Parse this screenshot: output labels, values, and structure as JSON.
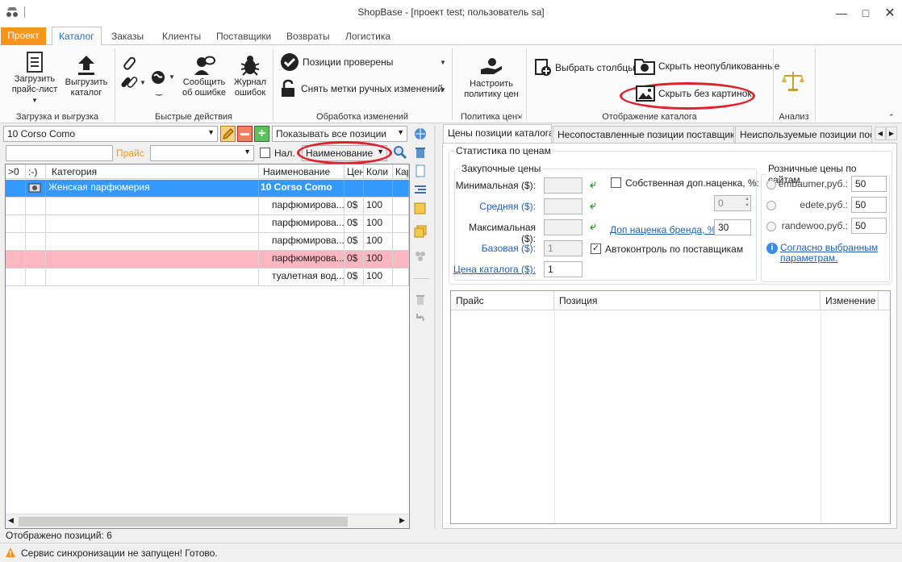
{
  "window": {
    "title": "ShopBase - [проект test; пользователь sa]"
  },
  "ribbon_tabs": [
    "Проект",
    "Каталог",
    "Заказы",
    "Клиенты",
    "Поставщики",
    "Возвраты",
    "Логистика"
  ],
  "groups": {
    "load": {
      "label": "Загрузка и выгрузка",
      "load_price_line1": "Загрузить",
      "load_price_line2": "прайс-лист",
      "export_line1": "Выгрузить",
      "export_line2": "каталог"
    },
    "quick": {
      "label": "Быстрые действия",
      "report_line1": "Сообщить",
      "report_line2": "об ошибке",
      "journal_line1": "Журнал",
      "journal_line2": "ошибок"
    },
    "changes": {
      "label": "Обработка изменений",
      "checked": "Позиции проверены",
      "remove_marks": "Снять метки ручных изменений"
    },
    "policy": {
      "label": "Политика цен",
      "setup_line1": "Настроить",
      "setup_line2": "политику цен"
    },
    "display": {
      "label": "Отображение каталога",
      "select_columns": "Выбрать столбцы",
      "hide_unpublished": "Скрыть неопубликованные",
      "hide_no_images": "Скрыть без картинок"
    },
    "analysis": {
      "label": "Анализ"
    }
  },
  "left": {
    "catalog_select": "10 Corso Como",
    "show_select": "Показывать все позиции",
    "price_label": "Прайс",
    "nal_label": "Нал.",
    "sort_select": "Наименование",
    "columns": [
      ">0",
      ":-)",
      "Категория",
      "Наименование",
      "Цен",
      "Коли",
      "Кар"
    ],
    "rows": [
      {
        "category": "Женская парфюмерия",
        "name": "10 Corso Como",
        "price": "",
        "qty": "",
        "state": "selected"
      },
      {
        "category": "",
        "name": "парфюмирова...",
        "price": "0$",
        "qty": "100",
        "state": "normal"
      },
      {
        "category": "",
        "name": "парфюмирова...",
        "price": "0$",
        "qty": "100",
        "state": "normal"
      },
      {
        "category": "",
        "name": "парфюмирова...",
        "price": "0$",
        "qty": "100",
        "state": "normal"
      },
      {
        "category": "",
        "name": "парфюмирова...",
        "price": "0$",
        "qty": "100",
        "state": "pink"
      },
      {
        "category": "",
        "name": "туалетная вод...",
        "price": "0$",
        "qty": "100",
        "state": "normal"
      }
    ]
  },
  "right": {
    "tabs": [
      "Цены позиции каталога",
      "Несопоставленные позиции поставщиков",
      "Неиспользуемые позиции поста"
    ],
    "stats_title": "Статистика по ценам",
    "purchase_title": "Закупочные цены",
    "min_label": "Минимальная ($):",
    "avg_label": "Средняя ($):",
    "max_label": "Максимальная ($):",
    "base_label": "Базовая ($):",
    "base_value": "1",
    "catalog_price_label": "Цена каталога ($):",
    "catalog_price_value": "1",
    "own_markup_label": "Собственная доп.наценка, %:",
    "own_markup_value": "0",
    "brand_markup_label": "Доп наценка бренда, %:",
    "brand_markup_value": "30",
    "autocontrol_label": "Автоконтроль по поставщикам",
    "retail_title": "Розничные цены по сайтам",
    "sites": [
      {
        "name": "embaumer,руб.:",
        "value": "50"
      },
      {
        "name": "edete,руб.:",
        "value": "50"
      },
      {
        "name": "randewoo,руб.:",
        "value": "50"
      }
    ],
    "agreed_line1": "Согласно выбранным",
    "agreed_line2": "параметрам.",
    "table_columns": [
      "Прайс",
      "Позиция",
      "Изменение"
    ]
  },
  "status": {
    "shown": "Отображено позиций: 6",
    "sync": "Сервис синхронизации не запущен!  Готово."
  },
  "colors": {
    "accent_orange": "#f7941d",
    "selected_row": "#3399ff",
    "pink_row": "#ffb6c1",
    "highlight_oval": "#e0202a",
    "link": "#1e5fb4"
  }
}
